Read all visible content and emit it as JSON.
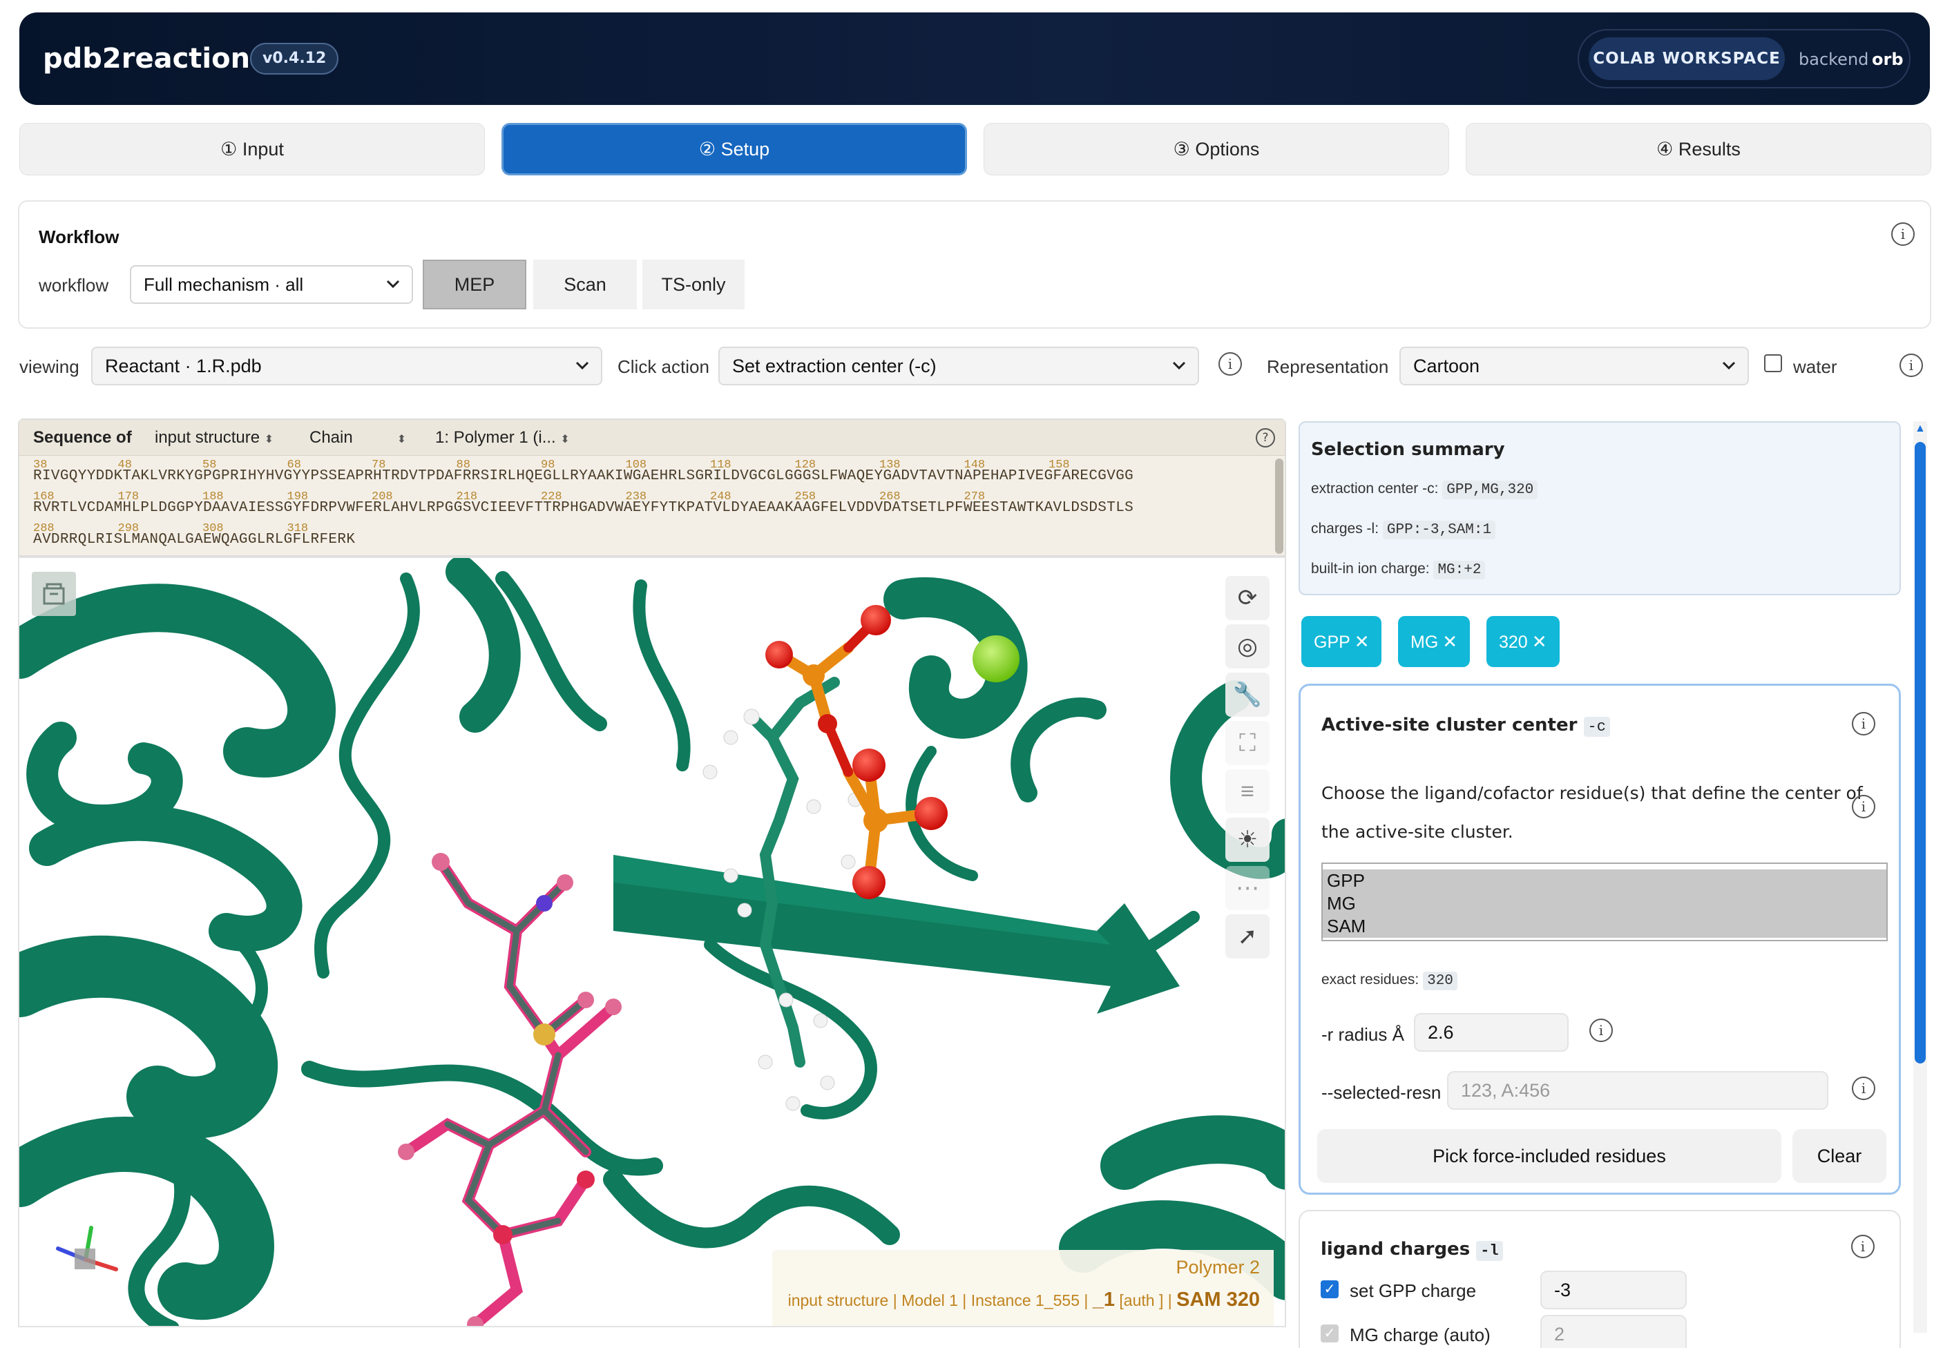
{
  "header": {
    "title": "pdb2reaction",
    "version": "v0.4.12",
    "workspace_badge": "COLAB WORKSPACE",
    "backend_label": "backend",
    "backend_value": "orb"
  },
  "tabs": [
    {
      "label": "① Input"
    },
    {
      "label": "② Setup"
    },
    {
      "label": "③ Options"
    },
    {
      "label": "④ Results"
    }
  ],
  "workflow": {
    "title": "Workflow",
    "label": "workflow",
    "selected": "Full mechanism · all",
    "modes": [
      "MEP",
      "Scan",
      "TS-only"
    ],
    "active_mode": "MEP"
  },
  "view_controls": {
    "viewing_label": "viewing",
    "viewing_value": "Reactant · 1.R.pdb",
    "click_action_label": "Click action",
    "click_action_value": "Set extraction center (-c)",
    "representation_label": "Representation",
    "representation_value": "Cartoon",
    "water_label": "water",
    "water_checked": false
  },
  "sequence": {
    "header_label": "Sequence of",
    "source": "input structure",
    "chain_label": "Chain",
    "polymer": "1: Polymer 1 (i...",
    "help": "?",
    "lines": [
      {
        "numbers": [
          "38",
          "48",
          "58",
          "68",
          "78",
          "88",
          "98",
          "108",
          "118",
          "128",
          "138",
          "148",
          "158"
        ],
        "residues": "RIVGQYYDDKTAKLVRKYGPGPRIHYHVGYYPSSEAPRHTRDVTPDAFRRSIRLHQEGLLRYAAKIWGAEHRLSGRILDVGCGLGGGSLFWAQEYGADVTAVTNAPEHAPIVEGFARECGVGG"
      },
      {
        "numbers": [
          "168",
          "178",
          "188",
          "198",
          "208",
          "218",
          "228",
          "238",
          "248",
          "258",
          "268",
          "278"
        ],
        "residues": "RVRTLVCDAMHLPLDGGPYDAAVAIESSGYFDRPVWFERLAHVLRPGGSVCIEEVFTTRPHGADVWAEYFYTKPATVLDYAEAAKAAGFELVDDVDATSETLPFWEESTAWTKAVLDSDSTLS"
      },
      {
        "numbers": [
          "288",
          "298",
          "308",
          "318"
        ],
        "residues": "AVDRRQLRISLMANQALGAEWQAGGLRLGFLRFERK"
      }
    ]
  },
  "viewer": {
    "tools": [
      "rotate-icon",
      "camera-icon",
      "wrench-icon",
      "expand-icon",
      "layers-icon",
      "light-icon",
      "more-icon",
      "cursor-icon"
    ],
    "info_polymer": "Polymer 2",
    "info_structure": "input structure",
    "info_model": "Model 1",
    "info_instance": "Instance 1_555",
    "info_chain": "_1",
    "info_auth": "[auth ]",
    "info_residue": "SAM 320"
  },
  "selection_summary": {
    "title": "Selection summary",
    "center_label": "extraction center -c:",
    "center_value": "GPP,MG,320",
    "charges_label": "charges -l:",
    "charges_value": "GPP:-3,SAM:1",
    "ion_label": "built-in ion charge:",
    "ion_value": "MG:+2"
  },
  "chips": [
    "GPP",
    "MG",
    "320"
  ],
  "cluster": {
    "title": "Active-site cluster center",
    "flag": "-c",
    "description_line1": "Choose the ligand/cofactor residue(s) that define the center of",
    "description_line2": "the active-site cluster.",
    "options": [
      {
        "label": "GPP",
        "selected": true
      },
      {
        "label": "MG",
        "selected": true
      },
      {
        "label": "SAM",
        "selected": true
      }
    ],
    "exact_label": "exact residues:",
    "exact_value": "320",
    "radius_label": "-r radius Å",
    "radius_value": "2.6",
    "selected_resn_label": "--selected-resn",
    "selected_resn_placeholder": "123, A:456",
    "pick_button": "Pick force-included residues",
    "clear_button": "Clear"
  },
  "ligand_charges": {
    "title": "ligand charges",
    "flag": "-l",
    "rows": [
      {
        "label": "set GPP charge",
        "value": "-3",
        "checked": true
      },
      {
        "label": "MG charge (auto)",
        "value": "2",
        "checked": true
      }
    ]
  },
  "colors": {
    "primary": "#1567c0",
    "chip": "#12b8d8",
    "protein": "#0f7a5c",
    "header_bg": "#0b1a34"
  }
}
